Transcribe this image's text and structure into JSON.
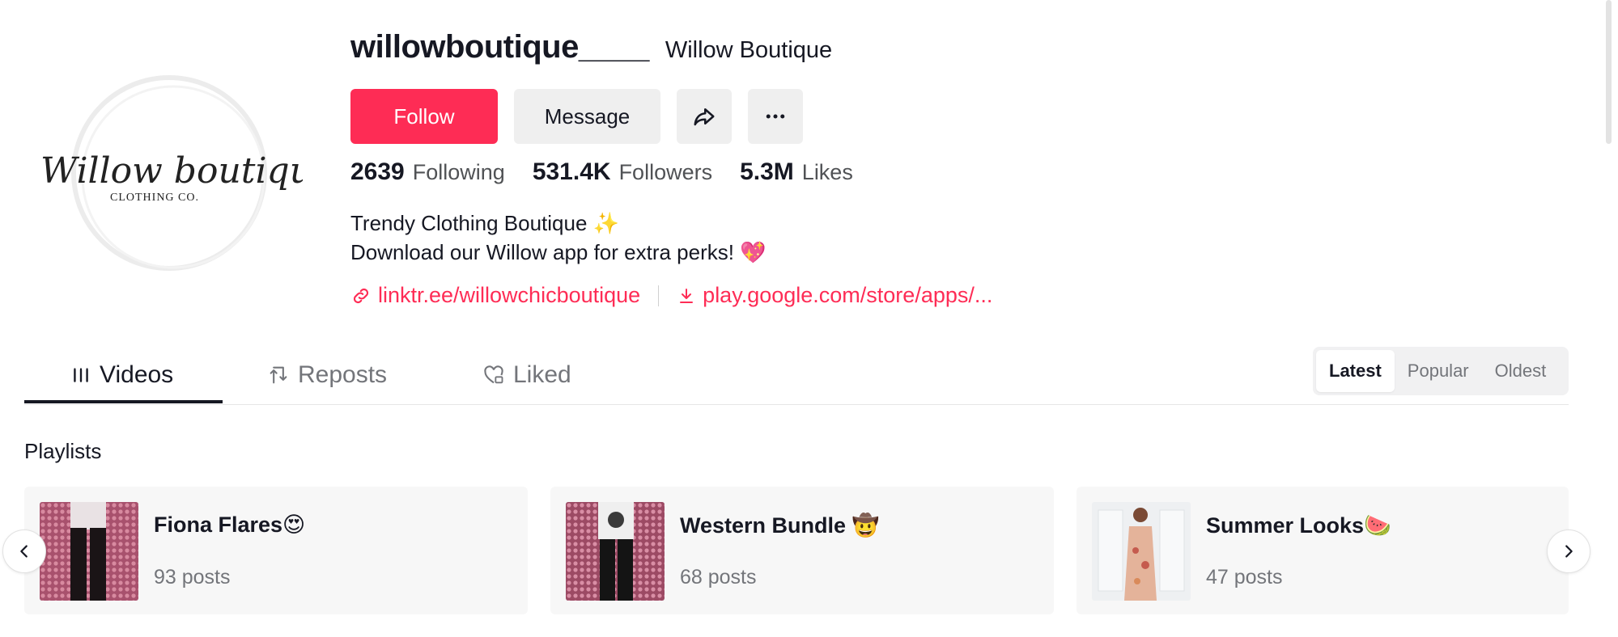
{
  "profile": {
    "username": "willowboutique____",
    "nickname": "Willow Boutique",
    "avatar_text_main": "Willow boutique",
    "avatar_text_sub": "CLOTHING CO."
  },
  "actions": {
    "follow_label": "Follow",
    "message_label": "Message",
    "share_icon": "share-icon",
    "more_icon": "more-icon"
  },
  "stats": {
    "following_count": "2639",
    "following_label": "Following",
    "followers_count": "531.4K",
    "followers_label": "Followers",
    "likes_count": "5.3M",
    "likes_label": "Likes"
  },
  "bio": {
    "line1": "Trendy Clothing Boutique ✨",
    "line2": "Download our Willow app for extra perks! 💖"
  },
  "links": {
    "link1": "linktr.ee/willowchicboutique",
    "link2": "play.google.com/store/apps/..."
  },
  "tabs": {
    "videos": "Videos",
    "reposts": "Reposts",
    "liked": "Liked"
  },
  "sort": {
    "latest": "Latest",
    "popular": "Popular",
    "oldest": "Oldest",
    "selected": "Latest"
  },
  "playlists": {
    "heading": "Playlists",
    "items": [
      {
        "title": "Fiona Flares😍",
        "count": "93 posts"
      },
      {
        "title": "Western Bundle 🤠",
        "count": "68 posts"
      },
      {
        "title": "Summer Looks🍉",
        "count": "47 posts"
      }
    ]
  },
  "colors": {
    "accent": "#fe2c55",
    "text_primary": "#161823",
    "text_secondary": "#73757a",
    "button_bg": "#efefef"
  }
}
